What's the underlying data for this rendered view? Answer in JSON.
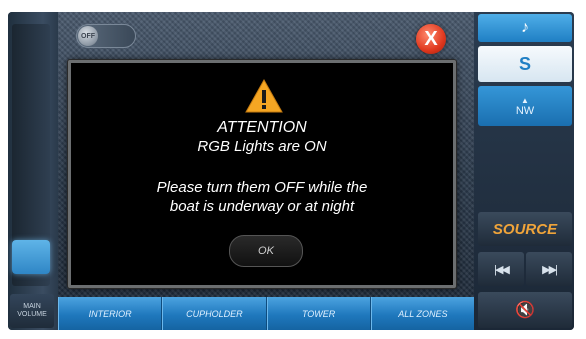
{
  "left": {
    "volume_label": "MAIN\nVOLUME"
  },
  "top": {
    "off_toggle_label": "OFF",
    "close_symbol": "X"
  },
  "dialog": {
    "title": "ATTENTION",
    "subtitle": "RGB Lights are ON",
    "message_line1": "Please turn them OFF while the",
    "message_line2": "boat is underway or at night",
    "ok_label": "OK",
    "warning_symbol": "!"
  },
  "zones": [
    {
      "label": "INTERIOR"
    },
    {
      "label": "CUPHOLDER"
    },
    {
      "label": "TOWER"
    },
    {
      "label": "ALL ZONES"
    }
  ],
  "right": {
    "music_icon": "♪",
    "sirius_icon": "S",
    "nav_label": "NW",
    "nav_arrow": "▲",
    "source_label": "SOURCE",
    "prev_symbol": "|◀◀",
    "next_symbol": "▶▶|",
    "mute_symbol": "🔇"
  },
  "colors": {
    "accent_blue": "#1f7fc4",
    "source_orange": "#f0a43a",
    "close_red": "#e0381e",
    "warning_amber": "#f5a623"
  }
}
